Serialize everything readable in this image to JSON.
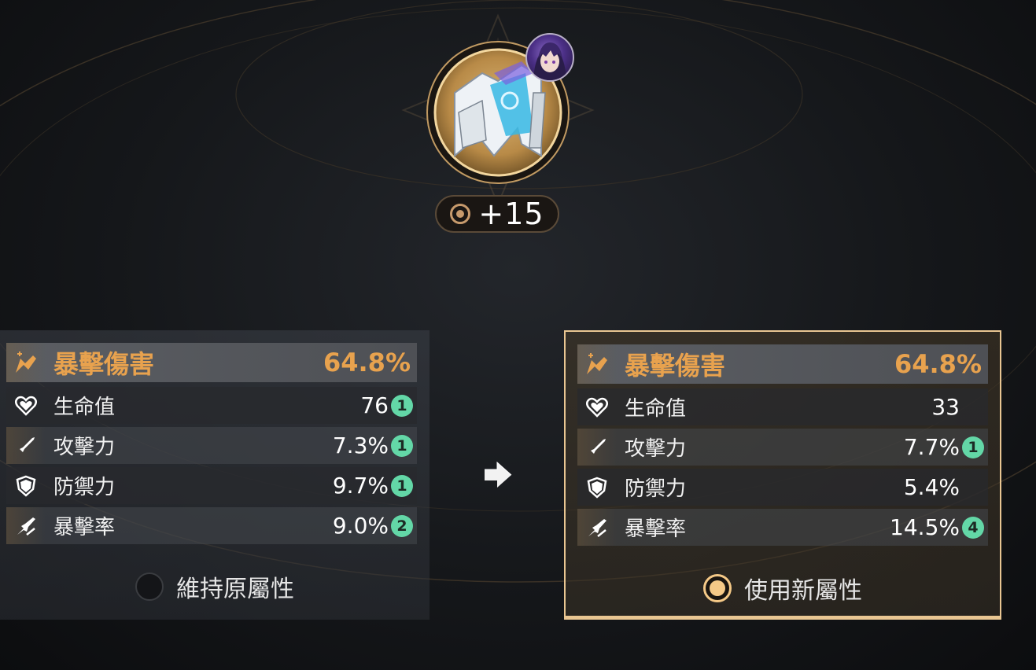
{
  "relic": {
    "level": "+15",
    "icon": "body-armor-relic-icon",
    "character": "character-avatar"
  },
  "colors": {
    "accent": "#e8a24e",
    "count_badge": "#63d7a7",
    "selected_border": "#e9c692"
  },
  "left_panel": {
    "main_stat": {
      "name": "暴擊傷害",
      "value": "64.8%",
      "icon": "crit-damage-icon"
    },
    "substats": [
      {
        "name": "生命值",
        "value": "76",
        "count": "1",
        "icon": "heart-icon"
      },
      {
        "name": "攻擊力",
        "value": "7.3%",
        "count": "1",
        "icon": "sword-icon"
      },
      {
        "name": "防禦力",
        "value": "9.7%",
        "count": "1",
        "icon": "shield-icon"
      },
      {
        "name": "暴擊率",
        "value": "9.0%",
        "count": "2",
        "icon": "crit-rate-icon"
      }
    ],
    "option_label": "維持原屬性",
    "selected": false
  },
  "right_panel": {
    "main_stat": {
      "name": "暴擊傷害",
      "value": "64.8%",
      "icon": "crit-damage-icon"
    },
    "substats": [
      {
        "name": "生命值",
        "value": "33",
        "count": "",
        "icon": "heart-icon"
      },
      {
        "name": "攻擊力",
        "value": "7.7%",
        "count": "1",
        "icon": "sword-icon"
      },
      {
        "name": "防禦力",
        "value": "5.4%",
        "count": "",
        "icon": "shield-icon"
      },
      {
        "name": "暴擊率",
        "value": "14.5%",
        "count": "4",
        "icon": "crit-rate-icon"
      }
    ],
    "option_label": "使用新屬性",
    "selected": true
  }
}
